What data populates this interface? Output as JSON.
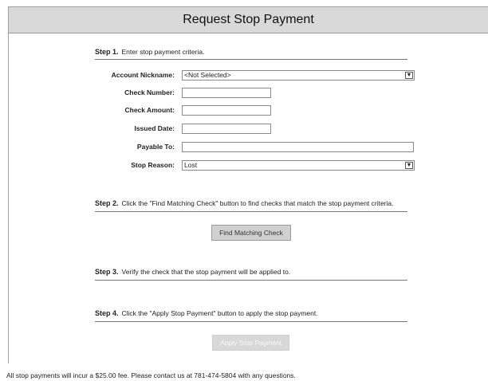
{
  "page": {
    "title": "Request Stop Payment"
  },
  "step1": {
    "label": "Step 1.",
    "text": "Enter stop payment criteria."
  },
  "form": {
    "account_nickname": {
      "label": "Account Nickname:",
      "value": "<Not Selected>"
    },
    "check_number": {
      "label": "Check Number:",
      "value": ""
    },
    "check_amount": {
      "label": "Check Amount:",
      "value": ""
    },
    "issued_date": {
      "label": "Issued Date:",
      "value": ""
    },
    "payable_to": {
      "label": "Payable To:",
      "value": ""
    },
    "stop_reason": {
      "label": "Stop Reason:",
      "value": "Lost"
    }
  },
  "step2": {
    "label": "Step 2.",
    "text": "Click the \"Find Matching Check\" button to find checks that match the stop payment criteria.",
    "button": "Find Matching Check"
  },
  "step3": {
    "label": "Step 3.",
    "text": "Verify the check that the stop payment will be applied to."
  },
  "step4": {
    "label": "Step 4.",
    "text": "Click the \"Apply Stop Payment\" button to apply the stop payment.",
    "button": "Apply Stop Payment"
  },
  "footer": {
    "text": "All stop payments will incur a $25.00 fee. Please contact us at 781-474-5804 with any questions."
  },
  "icons": {
    "dropdown": "chevron-down-icon"
  }
}
